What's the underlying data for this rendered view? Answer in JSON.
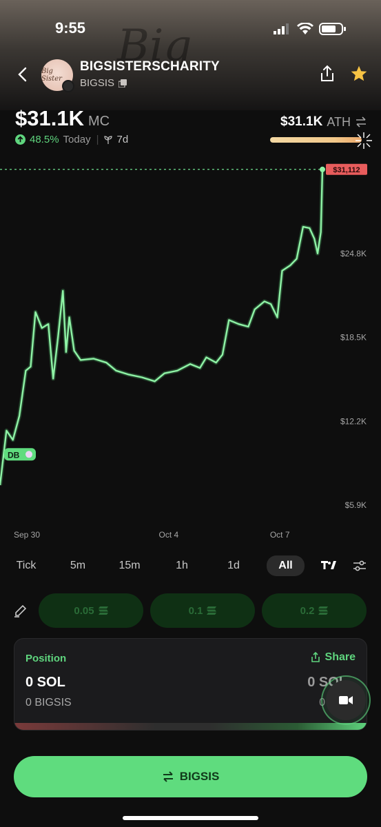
{
  "status_bar": {
    "time": "9:55"
  },
  "token": {
    "name": "BIGSISTERSCHARITY",
    "ticker": "BIGSIS",
    "avatar_text": "Big Sister"
  },
  "stats": {
    "market_cap": "$31.1K",
    "market_cap_unit": "MC",
    "change_pct": "48.5%",
    "change_period": "Today",
    "range": "7d",
    "ath_value": "$31.1K",
    "ath_label": "ATH"
  },
  "chart_data": {
    "type": "line",
    "y_ticks": [
      "$31.1K",
      "$24.8K",
      "$18.5K",
      "$12.2K",
      "$5.9K"
    ],
    "y_tick_values": [
      31100,
      24800,
      18500,
      12200,
      5900
    ],
    "x_ticks": [
      "Sep 30",
      "Oct 4",
      "Oct 7"
    ],
    "x_tick_positions": [
      0.0,
      0.47,
      0.83
    ],
    "current_price_label": "$31,112",
    "current_value": 31112,
    "marker_label": "DB",
    "ylim": [
      5900,
      31100
    ],
    "series": [
      {
        "values": [
          {
            "t": 0.0,
            "v": 7400
          },
          {
            "t": 0.02,
            "v": 11500
          },
          {
            "t": 0.04,
            "v": 10800
          },
          {
            "t": 0.06,
            "v": 12600
          },
          {
            "t": 0.08,
            "v": 16000
          },
          {
            "t": 0.095,
            "v": 16300
          },
          {
            "t": 0.11,
            "v": 20400
          },
          {
            "t": 0.13,
            "v": 19200
          },
          {
            "t": 0.15,
            "v": 19500
          },
          {
            "t": 0.165,
            "v": 15400
          },
          {
            "t": 0.18,
            "v": 18500
          },
          {
            "t": 0.195,
            "v": 22000
          },
          {
            "t": 0.205,
            "v": 17400
          },
          {
            "t": 0.215,
            "v": 20000
          },
          {
            "t": 0.23,
            "v": 17500
          },
          {
            "t": 0.25,
            "v": 16800
          },
          {
            "t": 0.29,
            "v": 16900
          },
          {
            "t": 0.33,
            "v": 16600
          },
          {
            "t": 0.36,
            "v": 16000
          },
          {
            "t": 0.4,
            "v": 15700
          },
          {
            "t": 0.44,
            "v": 15500
          },
          {
            "t": 0.48,
            "v": 15200
          },
          {
            "t": 0.51,
            "v": 15800
          },
          {
            "t": 0.55,
            "v": 16000
          },
          {
            "t": 0.59,
            "v": 16500
          },
          {
            "t": 0.62,
            "v": 16200
          },
          {
            "t": 0.64,
            "v": 17000
          },
          {
            "t": 0.67,
            "v": 16600
          },
          {
            "t": 0.69,
            "v": 17200
          },
          {
            "t": 0.71,
            "v": 19800
          },
          {
            "t": 0.74,
            "v": 19500
          },
          {
            "t": 0.77,
            "v": 19300
          },
          {
            "t": 0.79,
            "v": 20600
          },
          {
            "t": 0.82,
            "v": 21200
          },
          {
            "t": 0.84,
            "v": 21000
          },
          {
            "t": 0.86,
            "v": 20000
          },
          {
            "t": 0.875,
            "v": 23500
          },
          {
            "t": 0.9,
            "v": 23900
          },
          {
            "t": 0.92,
            "v": 24400
          },
          {
            "t": 0.94,
            "v": 26800
          },
          {
            "t": 0.96,
            "v": 26700
          },
          {
            "t": 0.975,
            "v": 25900
          },
          {
            "t": 0.985,
            "v": 24800
          },
          {
            "t": 0.995,
            "v": 26400
          },
          {
            "t": 1.0,
            "v": 31112
          }
        ]
      }
    ]
  },
  "timeframes": [
    "Tick",
    "5m",
    "15m",
    "1h",
    "1d",
    "All"
  ],
  "active_timeframe": "All",
  "quick_buy": [
    "0.05",
    "0.1",
    "0.2"
  ],
  "position": {
    "title": "Position",
    "share_label": "Share",
    "sol_amount": "0 SOL",
    "token_amount": "0 BIGSIS",
    "sol_amount_right": "0 SOL",
    "token_amount_right": "0"
  },
  "swap_button": {
    "label": "BIGSIS"
  },
  "colors": {
    "accent": "#5fdc7e",
    "line": "#8ff3a6",
    "price_tag": "#e85c5c"
  }
}
